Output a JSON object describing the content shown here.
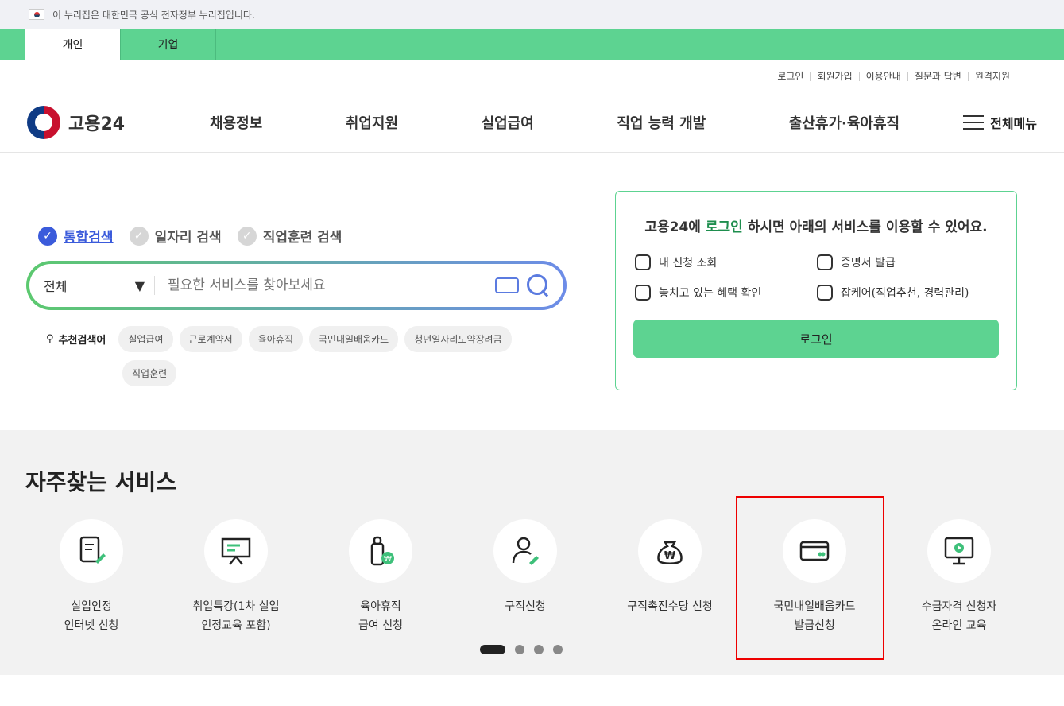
{
  "gov_banner": "이 누리집은 대한민국 공식 전자정부 누리집입니다.",
  "tabs": [
    {
      "label": "개인"
    },
    {
      "label": "기업"
    }
  ],
  "util_links": [
    "로그인",
    "회원가입",
    "이용안내",
    "질문과 답변",
    "원격지원"
  ],
  "logo": "고용24",
  "nav": [
    "채용정보",
    "취업지원",
    "실업급여",
    "직업 능력 개발",
    "출산휴가·육아휴직"
  ],
  "all_menu": "전체메뉴",
  "search": {
    "types": [
      "통합검색",
      "일자리 검색",
      "직업훈련 검색"
    ],
    "category": "전체",
    "placeholder": "필요한 서비스를 찾아보세요",
    "rec_label": "추천검색어",
    "rec_chips": [
      "실업급여",
      "근로계약서",
      "육아휴직",
      "국민내일배움카드",
      "청년일자리도약장려금",
      "직업훈련"
    ]
  },
  "login_card": {
    "msg_pre": "고용24에 ",
    "msg_hl": "로그인",
    "msg_post": " 하시면 아래의 서비스를 이용할 수 있어요.",
    "services": [
      "내 신청 조회",
      "증명서 발급",
      "놓치고 있는 혜택 확인",
      "잡케어(직업추천, 경력관리)"
    ],
    "button": "로그인"
  },
  "freq": {
    "title": "자주찾는 서비스",
    "items": [
      {
        "line1": "실업인정",
        "line2": "인터넷 신청",
        "icon": "document-pen-icon"
      },
      {
        "line1": "취업특강(1차 실업",
        "line2": "인정교육 포함)",
        "icon": "presentation-board-icon"
      },
      {
        "line1": "육아휴직",
        "line2": "급여 신청",
        "icon": "baby-bottle-won-icon"
      },
      {
        "line1": "구직신청",
        "line2": "",
        "icon": "person-pen-icon"
      },
      {
        "line1": "구직촉진수당 신청",
        "line2": "",
        "icon": "money-bag-icon"
      },
      {
        "line1": "국민내일배움카드",
        "line2": "발급신청",
        "icon": "card-icon"
      },
      {
        "line1": "수급자격 신청자",
        "line2": "온라인 교육",
        "icon": "monitor-play-icon"
      }
    ]
  },
  "accent": "#5dd391"
}
